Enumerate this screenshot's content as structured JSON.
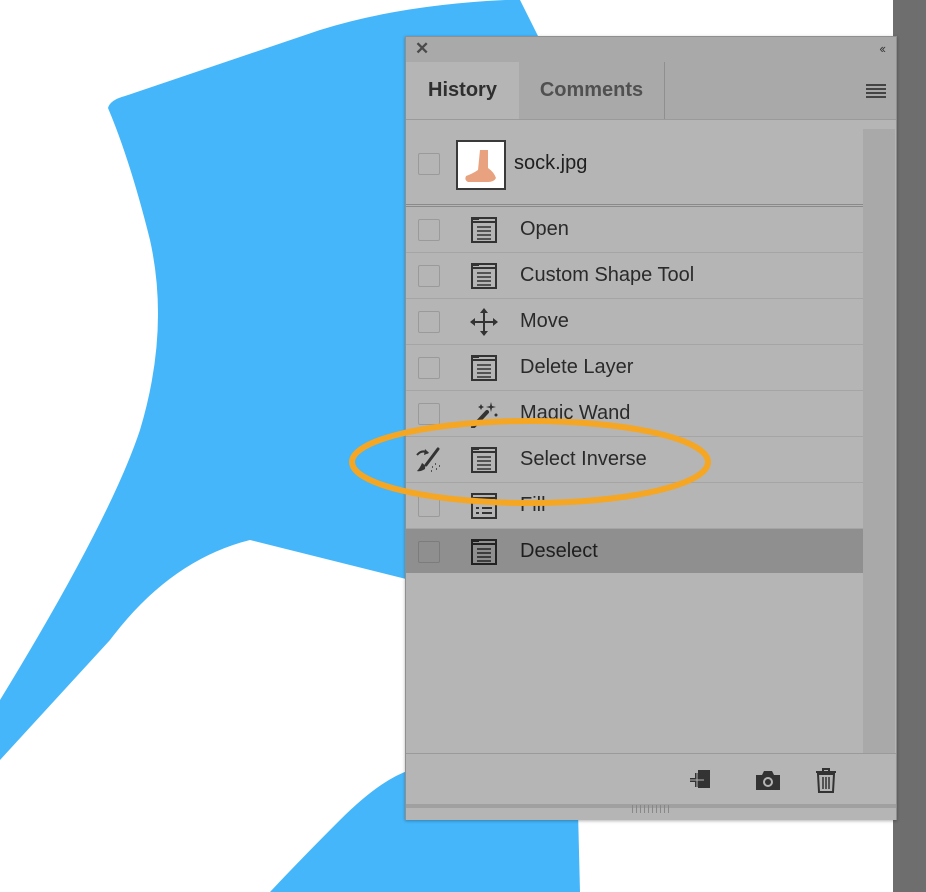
{
  "panel": {
    "close_glyph": "✕",
    "collapse_glyph": "‹‹",
    "tabs": [
      {
        "label": "History",
        "active": true
      },
      {
        "label": "Comments",
        "active": false
      }
    ],
    "menu_icon": "panel-menu-icon"
  },
  "snapshot": {
    "name": "sock.jpg",
    "thumbnail_icon": "foot-thumbnail"
  },
  "history": [
    {
      "label": "Open",
      "icon": "document-icon",
      "selected": false
    },
    {
      "label": "Custom Shape Tool",
      "icon": "document-icon",
      "selected": false
    },
    {
      "label": "Move",
      "icon": "move-arrows-icon",
      "selected": false
    },
    {
      "label": "Delete Layer",
      "icon": "document-icon",
      "selected": false
    },
    {
      "label": "Magic Wand",
      "icon": "magic-wand-icon",
      "selected": false
    },
    {
      "label": "Select Inverse",
      "icon": "document-icon",
      "selected": false,
      "history_brush_source": true
    },
    {
      "label": "Fill",
      "icon": "list-icon",
      "selected": false
    },
    {
      "label": "Deselect",
      "icon": "document-icon",
      "selected": true
    }
  ],
  "footer": {
    "buttons": [
      "new-document-from-state-icon",
      "camera-snapshot-icon",
      "trash-icon"
    ]
  },
  "colors": {
    "canvas_shape": "#45b6fa",
    "highlight_ring": "#f5a623",
    "panel_bg": "#b5b5b5",
    "selected_row": "#8f8f8f"
  }
}
